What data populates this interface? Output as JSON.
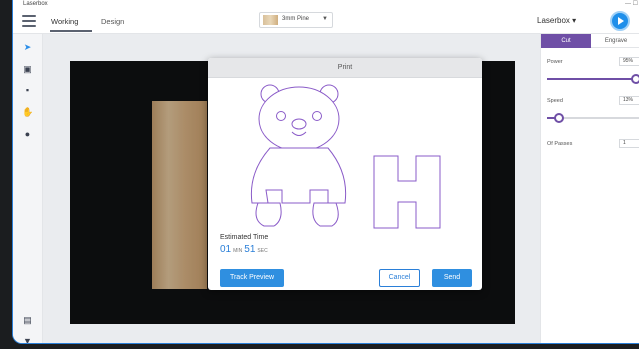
{
  "app": {
    "title": "Laserbox"
  },
  "header": {
    "tabs": [
      {
        "label": "Working",
        "active": true
      },
      {
        "label": "Design",
        "active": false
      }
    ],
    "material": {
      "label": "3mm Pine"
    },
    "device_name": "Laserbox ▾"
  },
  "left_tools": [
    {
      "icon": "pointer-icon"
    },
    {
      "icon": "camera-scan-icon"
    },
    {
      "icon": "image-icon"
    },
    {
      "icon": "hand-icon"
    },
    {
      "icon": "zoom-icon"
    },
    {
      "icon": "layers-icon"
    },
    {
      "icon": "cart-icon"
    }
  ],
  "dialog": {
    "title": "Print",
    "estimated_label": "Estimated Time",
    "minutes": "01",
    "min_unit": "MIN",
    "seconds": "51",
    "sec_unit": "SEC",
    "track_preview_label": "Track Preview",
    "cancel_label": "Cancel",
    "send_label": "Send"
  },
  "settings": {
    "cut_tab": "Cut",
    "engrave_tab": "Engrave",
    "power_label": "Power",
    "power_value": "95%",
    "power_fraction": 0.95,
    "speed_label": "Speed",
    "speed_value": "13%",
    "speed_fraction": 0.13,
    "passes_label": "Of Passes",
    "passes_value": "1"
  },
  "colors": {
    "accent": "#2f8fe0",
    "purple": "#6f4fa6",
    "outline": "#8a5bc8"
  }
}
